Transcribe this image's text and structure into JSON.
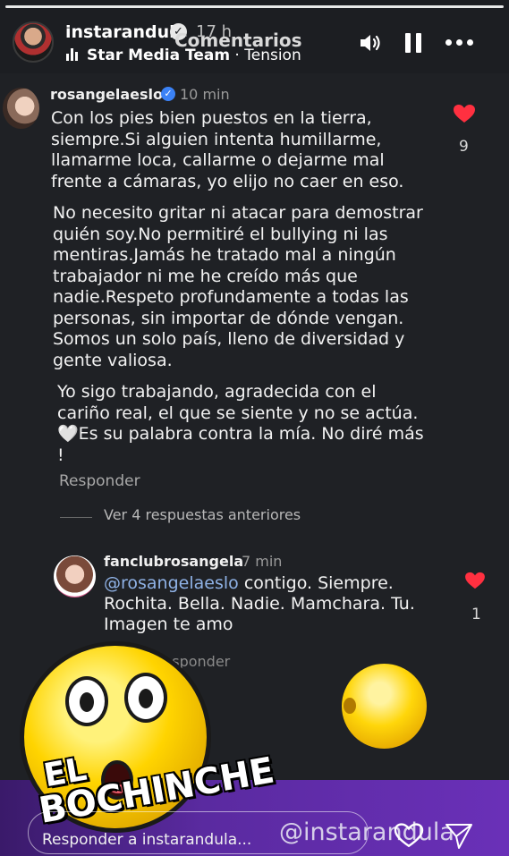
{
  "header": {
    "username": "instarandula",
    "time_ago": "17 h",
    "sheet_title": "Comentarios",
    "music_artist": "Star Media Team",
    "music_separator": " · ",
    "music_song": "Tension"
  },
  "comment": {
    "username": "rosangelaeslo",
    "time": "10 min",
    "paragraphs": [
      "Con los pies bien puestos en la tierra, siempre.Si alguien intenta humillarme, llamarme loca, callarme o dejarme mal frente a cámaras, yo elijo no caer en eso.",
      "No necesito gritar ni atacar para demostrar quién soy.No permitiré el bullying ni las mentiras.Jamás he tratado mal a ningún trabajador ni me he creído más que nadie.Respeto profundamente a todas las personas, sin importar de dónde vengan. Somos un solo país, lleno de diversidad y gente valiosa.",
      "Yo sigo trabajando, agradecida con el cariño real, el que se siente y no se actúa. 🤍Es su palabra contra la mía. No diré más !"
    ],
    "likes": "9",
    "reply_label": "Responder",
    "view_replies": "Ver 4 respuestas anteriores"
  },
  "reply": {
    "username": "fanclubrosangela",
    "time": "7 min",
    "mention": "@rosangelaeslo",
    "text": " contigo. Siempre. Rochita. Bella. Nadie. Mamchara. Tu. Imagen  te amo",
    "likes": "1",
    "reply_label": "Responder"
  },
  "overlay": {
    "brand_line1": "EL",
    "brand_line2": "BOCHINCHE"
  },
  "footer": {
    "input_placeholder": "Responder a instarandula...",
    "watermark": "@instarandula"
  },
  "colors": {
    "background": "#1f2125",
    "like_red": "#ff3040",
    "mention_blue": "#8fb2e6",
    "brand_purple": "#5a2aa0"
  },
  "icons": [
    "verified-icon",
    "music-bars-icon",
    "sound-icon",
    "pause-icon",
    "more-icon",
    "heart-icon",
    "send-icon"
  ]
}
